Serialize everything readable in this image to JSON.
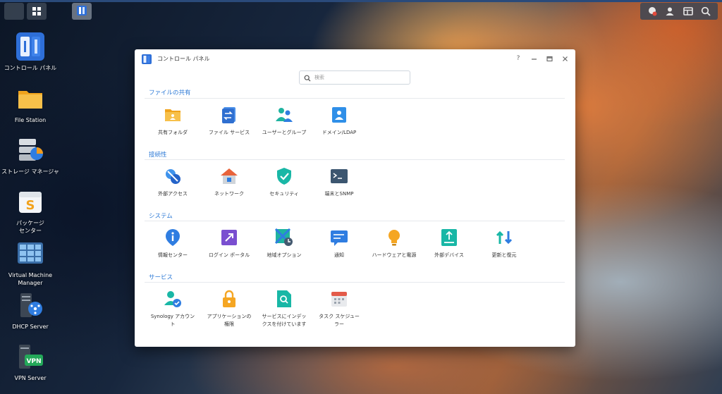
{
  "colors": {
    "accent": "#2d7ad6",
    "window_bg": "#ffffff"
  },
  "taskbar": {
    "main_menu_icon": "grid-icon",
    "control_panel_task_icon": "control-panel-icon",
    "right_icons": [
      "notification-icon",
      "user-icon",
      "widgets-icon",
      "search-icon"
    ]
  },
  "desktop": {
    "icons": [
      {
        "label": "コントロール パネル",
        "icon": "control-panel-icon"
      },
      {
        "label": "File Station",
        "icon": "folder-icon"
      },
      {
        "label": "ストレージ マネージャ",
        "icon": "storage-icon"
      },
      {
        "label": "パッケージ\nセンター",
        "icon": "package-icon"
      },
      {
        "label": "Virtual Machine\nManager",
        "icon": "vm-icon"
      },
      {
        "label": "DHCP Server",
        "icon": "dhcp-icon"
      },
      {
        "label": "VPN Server",
        "icon": "vpn-icon"
      }
    ]
  },
  "window": {
    "title": "コントロール パネル",
    "help": "?",
    "search_placeholder": "検索",
    "sections": [
      {
        "title": "ファイルの共有",
        "items": [
          {
            "label": "共有フォルダ",
            "icon": "shared-folder-icon"
          },
          {
            "label": "ファイル サービス",
            "icon": "file-services-icon"
          },
          {
            "label": "ユーザーとグループ",
            "icon": "user-group-icon"
          },
          {
            "label": "ドメイン/LDAP",
            "icon": "domain-ldap-icon"
          }
        ]
      },
      {
        "title": "接続性",
        "items": [
          {
            "label": "外部アクセス",
            "icon": "external-access-icon"
          },
          {
            "label": "ネットワーク",
            "icon": "network-icon"
          },
          {
            "label": "セキュリティ",
            "icon": "security-icon"
          },
          {
            "label": "端末とSNMP",
            "icon": "terminal-snmp-icon"
          }
        ]
      },
      {
        "title": "システム",
        "items": [
          {
            "label": "情報センター",
            "icon": "info-center-icon"
          },
          {
            "label": "ログイン ポータル",
            "icon": "login-portal-icon"
          },
          {
            "label": "地域オプション",
            "icon": "regional-options-icon"
          },
          {
            "label": "通知",
            "icon": "notification-icon"
          },
          {
            "label": "ハードウェアと電源",
            "icon": "hardware-power-icon"
          },
          {
            "label": "外部デバイス",
            "icon": "external-devices-icon"
          },
          {
            "label": "更新と復元",
            "icon": "update-restore-icon"
          }
        ]
      },
      {
        "title": "サービス",
        "items": [
          {
            "label": "Synology アカウン\nト",
            "icon": "synology-account-icon"
          },
          {
            "label": "アプリケーションの\n権限",
            "icon": "application-privileges-icon"
          },
          {
            "label": "サービスにインデッ\nクスを付けています",
            "icon": "indexing-service-icon"
          },
          {
            "label": "タスク スケジュー\nラー",
            "icon": "task-scheduler-icon"
          }
        ]
      }
    ]
  }
}
